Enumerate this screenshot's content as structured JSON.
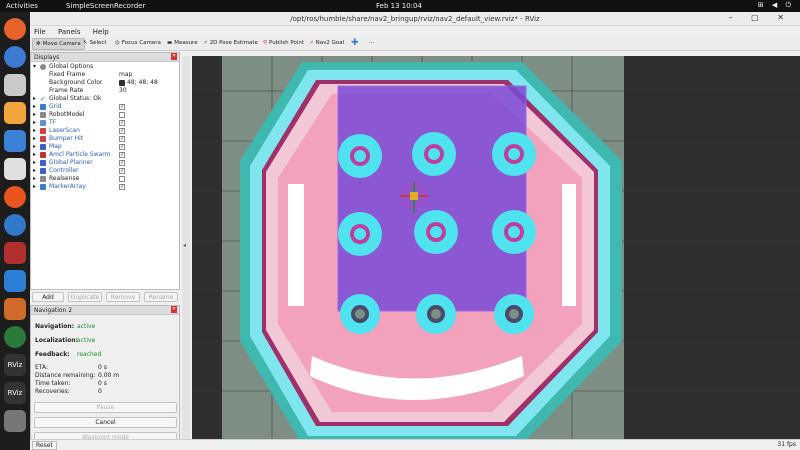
{
  "topbar": {
    "activities": "Activities",
    "app": "SimpleScreenRecorder",
    "clock": "Feb 13  10:04",
    "tray": "⊞ ◀ ⏻"
  },
  "window": {
    "title": "/opt/ros/humble/share/nav2_bringup/rviz/nav2_default_view.rviz* - RViz",
    "controls": "– ▢ ✕"
  },
  "menu": [
    "File",
    "Panels",
    "Help"
  ],
  "toolbar": {
    "tools": [
      "Move Camera",
      "Select",
      "Focus Camera",
      "Measure",
      "2D Pose Estimate",
      "Publish Point",
      "Nav2 Goal"
    ],
    "more": "···"
  },
  "displays": {
    "title": "Displays",
    "global_options": "Global Options",
    "fixed_frame_label": "Fixed Frame",
    "fixed_frame": "map",
    "bg_label": "Background Color",
    "bg": "48; 48; 48",
    "frame_rate_label": "Frame Rate",
    "frame_rate": "30",
    "global_status": "Global Status: Ok",
    "items": [
      "Grid",
      "RobotModel",
      "TF",
      "LaserScan",
      "Bumper Hit",
      "Map",
      "Amcl Particle Swarm",
      "Global Planner",
      "Controller",
      "Realsense",
      "MarkerArray"
    ],
    "checked": [
      true,
      false,
      true,
      true,
      true,
      true,
      true,
      true,
      true,
      false,
      true
    ],
    "buttons": [
      "Add",
      "Duplicate",
      "Remove",
      "Rename"
    ]
  },
  "nav2": {
    "title": "Navigation 2",
    "navigation_label": "Navigation:",
    "navigation": "active",
    "localization_label": "Localization:",
    "localization": "active",
    "feedback_label": "Feedback:",
    "feedback": "reached",
    "eta_label": "ETA:",
    "eta": "0 s",
    "dist_label": "Distance remaining:",
    "dist": "0.00 m",
    "time_label": "Time taken:",
    "time": "0 s",
    "rec_label": "Recoveries:",
    "rec": "0",
    "pause": "Pause",
    "cancel": "Cancel",
    "waypoint": "Waypoint mode"
  },
  "status": {
    "reset": "Reset",
    "fps": "31 fps"
  },
  "colors": {
    "accent": "#2a5fb0",
    "ok": "#1e8c2a",
    "map_bg": "#2f2f2f"
  }
}
